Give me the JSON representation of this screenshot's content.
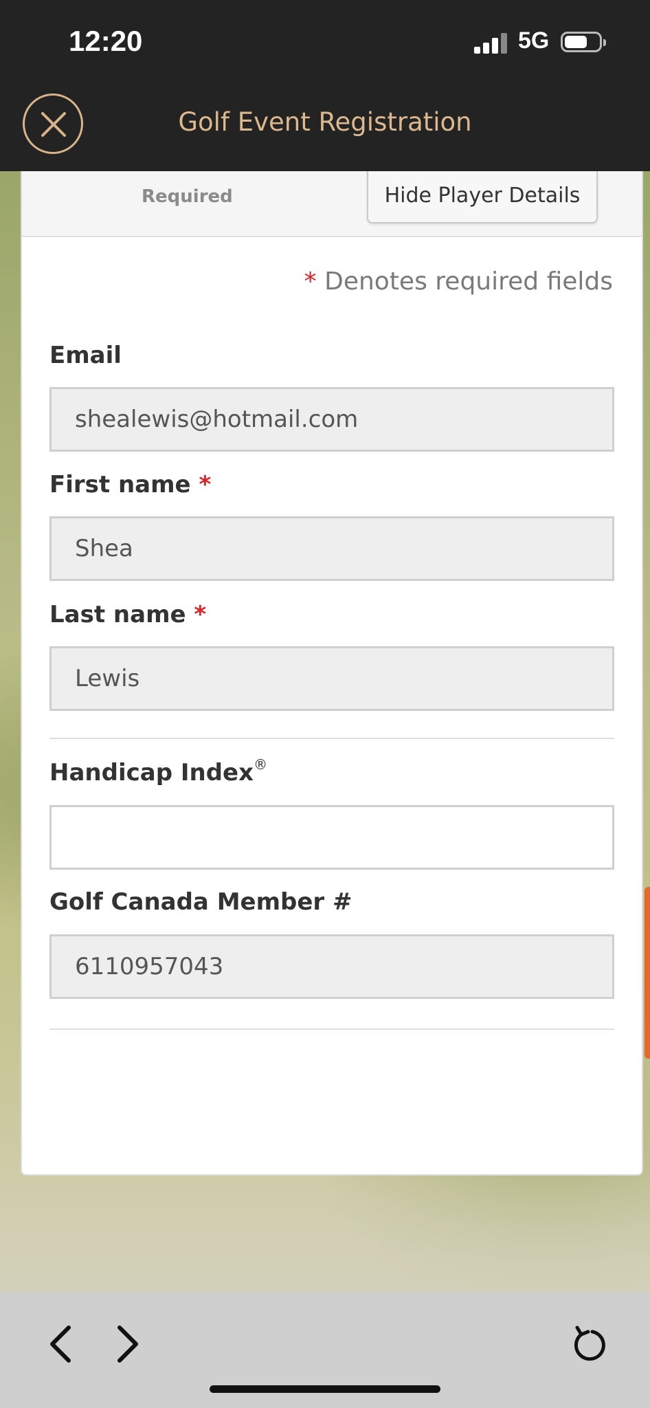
{
  "status_bar": {
    "time": "12:20",
    "network": "5G"
  },
  "header": {
    "title": "Golf Event Registration"
  },
  "card": {
    "required_tab": "Required",
    "hide_button": "Hide Player Details",
    "required_note_star": "*",
    "required_note": "Denotes required fields"
  },
  "fields": {
    "email": {
      "label": "Email",
      "value": "shealewis@hotmail.com"
    },
    "first_name": {
      "label": "First name",
      "required_marker": "*",
      "value": "Shea"
    },
    "last_name": {
      "label": "Last name",
      "required_marker": "*",
      "value": "Lewis"
    },
    "handicap": {
      "label": "Handicap Index",
      "mark": "®",
      "value": ""
    },
    "member": {
      "label": "Golf Canada Member #",
      "value": "6110957043"
    }
  },
  "colors": {
    "accent": "#dcb88e",
    "required": "#d9252a",
    "header_bg": "#232323"
  }
}
